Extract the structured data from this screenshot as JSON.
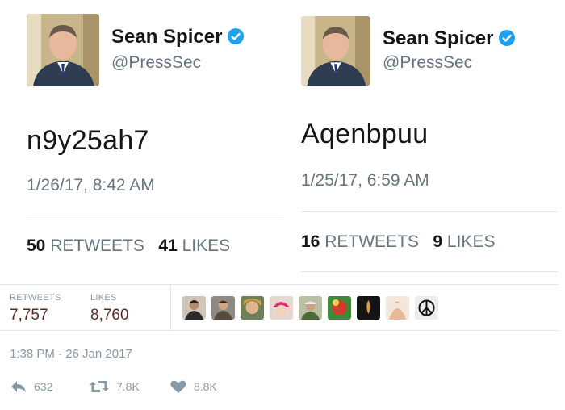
{
  "left_tweet": {
    "name": "Sean Spicer",
    "handle": "@PressSec",
    "text": "n9y25ah7",
    "timestamp": "1/26/17, 8:42 AM",
    "retweets_count": "50",
    "retweets_label": "RETWEETS",
    "likes_count": "41",
    "likes_label": "LIKES"
  },
  "right_tweet": {
    "name": "Sean Spicer",
    "handle": "@PressSec",
    "text": "Aqenbpuu",
    "timestamp": "1/25/17, 6:59 AM",
    "retweets_count": "16",
    "retweets_label": "RETWEETS",
    "likes_count": "9",
    "likes_label": "LIKES"
  },
  "bottom_tweet": {
    "retweets_label": "RETWEETS",
    "retweets_count": "7,757",
    "likes_label": "LIKES",
    "likes_count": "8,760",
    "liker_avatars": [
      "face-1",
      "face-2",
      "face-3",
      "face-4",
      "face-5",
      "face-6",
      "face-7",
      "face-8",
      "peace-symbol"
    ],
    "timestamp": "1:38 PM - 26 Jan 2017",
    "reply_count": "632",
    "retweet_count": "7.8K",
    "like_count": "8.8K"
  },
  "colors": {
    "verified": "#1da1f2",
    "count_red": "#5c2a23",
    "muted": "#66757f"
  }
}
